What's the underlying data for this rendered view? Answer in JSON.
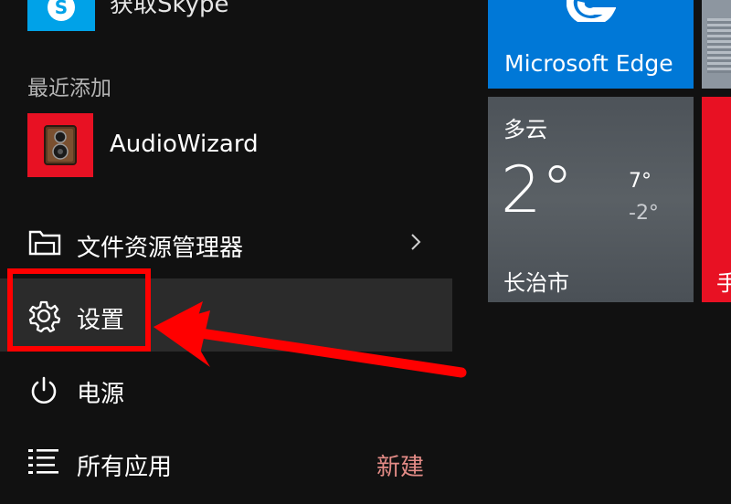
{
  "start_menu": {
    "apps": {
      "skype_label": "获取Skype",
      "recent_title": "最近添加",
      "audiowizard_label": "AudioWizard"
    },
    "nav": {
      "explorer_label": "文件资源管理器",
      "settings_label": "设置",
      "power_label": "电源",
      "all_apps_label": "所有应用",
      "new_badge": "新建"
    },
    "tiles": {
      "edge_label": "Microsoft Edge",
      "weather": {
        "condition": "多云",
        "temperature": "2°",
        "high": "7°",
        "low": "-2°",
        "city": "长治市"
      },
      "red_tile_label": "手"
    }
  },
  "colors": {
    "background": "#111111",
    "accent_blue": "#0078d7",
    "accent_red": "#e81123",
    "highlight_red": "#ff0000",
    "selected_row": "#2b2b2b"
  },
  "icons": [
    "skype-icon",
    "speaker-icon",
    "folder-icon",
    "gear-icon",
    "power-icon",
    "list-icon",
    "chevron-right-icon",
    "edge-icon"
  ]
}
